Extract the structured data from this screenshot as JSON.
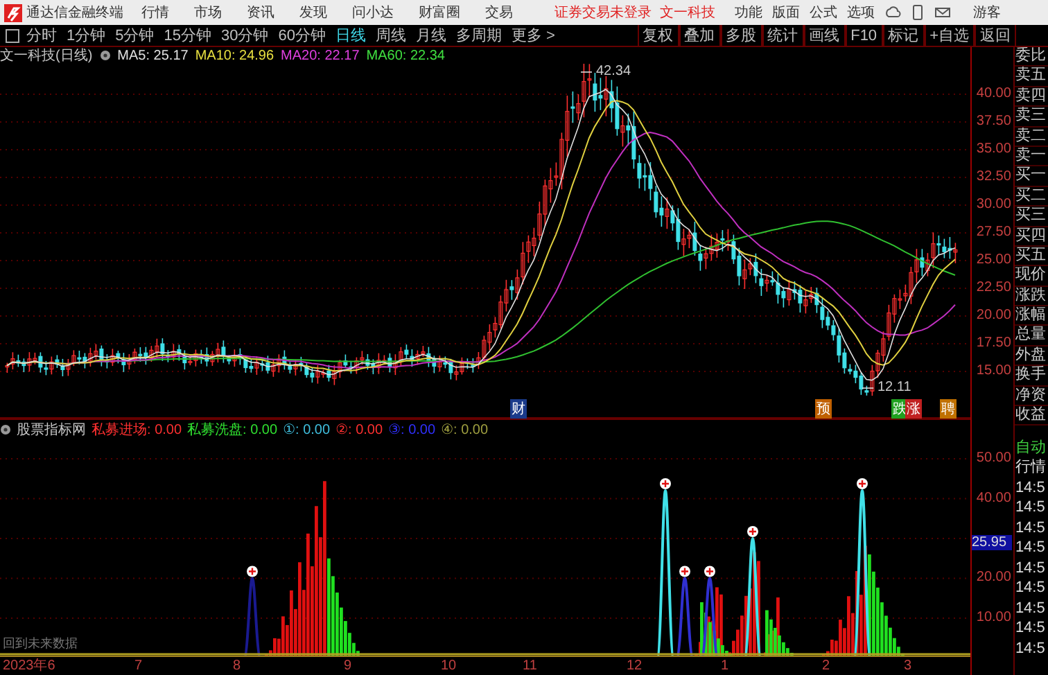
{
  "title_bar": {
    "app_name": "通达信金融终端",
    "menus": [
      "行情",
      "市场",
      "资讯",
      "发现",
      "问小达",
      "财富圈",
      "交易"
    ],
    "status": "证券交易未登录",
    "stock": "文一科技",
    "menus_right": [
      "功能",
      "版面",
      "公式",
      "选项"
    ],
    "user": "游客"
  },
  "period_tabs": [
    {
      "label": "分时",
      "selected": false
    },
    {
      "label": "1分钟",
      "selected": false
    },
    {
      "label": "5分钟",
      "selected": false
    },
    {
      "label": "15分钟",
      "selected": false
    },
    {
      "label": "30分钟",
      "selected": false
    },
    {
      "label": "60分钟",
      "selected": false
    },
    {
      "label": "日线",
      "selected": true
    },
    {
      "label": "周线",
      "selected": false
    },
    {
      "label": "月线",
      "selected": false
    },
    {
      "label": "多周期",
      "selected": false
    },
    {
      "label": "更多 >",
      "selected": false
    }
  ],
  "tools": [
    "复权",
    "叠加",
    "多股",
    "统计",
    "画线",
    "F10",
    "标记",
    "+自选",
    "返回"
  ],
  "price_pane": {
    "title": "文一科技(日线)",
    "ma": [
      {
        "label": "MA5: 25.17",
        "color": "#e0e0e0"
      },
      {
        "label": "MA10: 24.96",
        "color": "#e8e040"
      },
      {
        "label": "MA20: 22.17",
        "color": "#e040e0"
      },
      {
        "label": "MA60: 22.34",
        "color": "#40e040"
      }
    ],
    "y_ticks": [
      "40.00",
      "37.50",
      "35.00",
      "32.50",
      "30.00",
      "27.50",
      "25.00",
      "22.50",
      "20.00",
      "17.50",
      "15.00"
    ],
    "high_label": "42.34",
    "low_label": "12.11",
    "markers": [
      {
        "text": "财",
        "color": "#1a3a8a"
      },
      {
        "text": "预",
        "color": "#c06000"
      },
      {
        "text": "跌",
        "color": "#20a020"
      },
      {
        "text": "涨",
        "color": "#c02020"
      },
      {
        "text": "聘",
        "color": "#c07000"
      }
    ]
  },
  "indicator_pane": {
    "title": "股票指标网",
    "values": [
      {
        "label": "私募进场:",
        "value": "0.00",
        "color": "#ff3030"
      },
      {
        "label": "私募洗盘:",
        "value": "0.00",
        "color": "#30e030"
      },
      {
        "label": "①:",
        "value": "0.00",
        "color": "#40c0e0"
      },
      {
        "label": "②:",
        "value": "0.00",
        "color": "#ff3030"
      },
      {
        "label": "③:",
        "value": "0.00",
        "color": "#3030ff"
      },
      {
        "label": "④:",
        "value": "0.00",
        "color": "#a0a040"
      }
    ],
    "y_ticks": [
      "50.00",
      "40.00",
      "20.00",
      "10.00"
    ],
    "current_value": "25.95",
    "footer": "回到未来数据"
  },
  "date_axis": [
    "2023年6",
    "7",
    "8",
    "9",
    "10",
    "11",
    "12",
    "1",
    "2",
    "3"
  ],
  "quote_panel": [
    "委比",
    "卖五",
    "卖四",
    "卖三",
    "卖二",
    "卖一",
    "买一",
    "买二",
    "买三",
    "买四",
    "买五",
    "现价",
    "涨跌",
    "涨幅",
    "总量",
    "外盘",
    "换手",
    "净资",
    "收益"
  ],
  "tick_panel": {
    "mode": "自动",
    "title": "行情",
    "times": [
      "14:5",
      "14:5",
      "14:5",
      "14:5",
      "14:5",
      "14:5",
      "14:5",
      "14:5",
      "14:5"
    ]
  }
}
